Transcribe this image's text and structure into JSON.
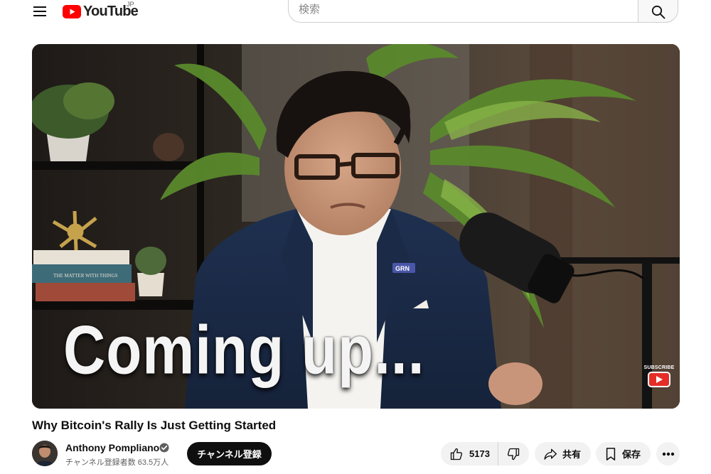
{
  "masthead": {
    "logo_text": "YouTube",
    "region_code": "JP",
    "search_placeholder": "検索",
    "icons": {
      "menu": "hamburger-menu-icon",
      "search": "magnifier-icon"
    }
  },
  "player": {
    "overlay_text": "Coming up...",
    "lapel_pin_text": "GRN",
    "book_spine_text": "THE MATTER WITH THINGS",
    "watermark_label": "SUBSCRIBE"
  },
  "video": {
    "title": "Why Bitcoin's Rally Is Just Getting Started"
  },
  "owner": {
    "channel_name": "Anthony Pompliano",
    "verified": true,
    "subscriber_count": "チャンネル登録者数 63.5万人",
    "subscribe_label": "チャンネル登録"
  },
  "actions": {
    "like_count": "5173",
    "share_label": "共有",
    "save_label": "保存"
  },
  "colors": {
    "brand_red": "#ff0000",
    "text_primary": "#0f0f0f",
    "text_secondary": "#606060",
    "chip_bg": "#f2f2f2"
  }
}
